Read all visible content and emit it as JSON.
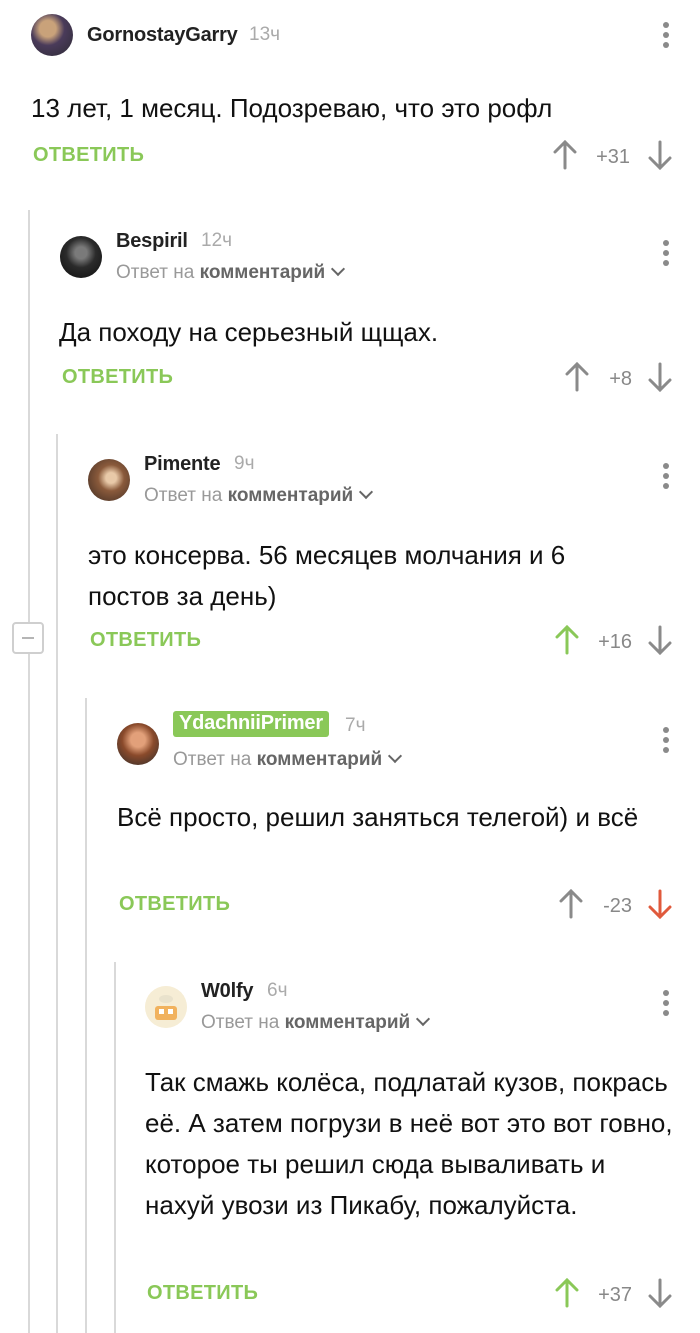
{
  "reply_label": "ОТВЕТИТЬ",
  "reply_to": {
    "prefix": "Ответ на",
    "target": "комментарий"
  },
  "colors": {
    "accent": "#8ac858",
    "downvote_active": "#e05a3c",
    "muted": "#999999"
  },
  "comments": [
    {
      "user": "GornostayGarry",
      "time": "13ч",
      "badge": false,
      "is_reply": false,
      "text": "13 лет, 1 месяц. Подозреваю, что это рофл",
      "rating": "+31",
      "vote": "none"
    },
    {
      "user": "Bespiril",
      "time": "12ч",
      "badge": false,
      "is_reply": true,
      "text": "Да походу на серьезный щщах.",
      "rating": "+8",
      "vote": "none"
    },
    {
      "user": "Pimente",
      "time": "9ч",
      "badge": false,
      "is_reply": true,
      "text": "это консерва. 56 месяцев молчания и 6 постов за день)",
      "rating": "+16",
      "vote": "up"
    },
    {
      "user": "YdachniiPrimer",
      "time": "7ч",
      "badge": true,
      "is_reply": true,
      "text": "Всё просто, решил заняться телегой) и всё",
      "rating": "-23",
      "vote": "down"
    },
    {
      "user": "W0lfy",
      "time": "6ч",
      "badge": false,
      "is_reply": true,
      "text": "Так смажь колёса, подлатай кузов, покрась её. А затем погрузи в неё вот это вот говно, которое ты решил сюда вываливать и нахуй увози из Пикабу, пожалуйста.",
      "rating": "+37",
      "vote": "up"
    }
  ]
}
